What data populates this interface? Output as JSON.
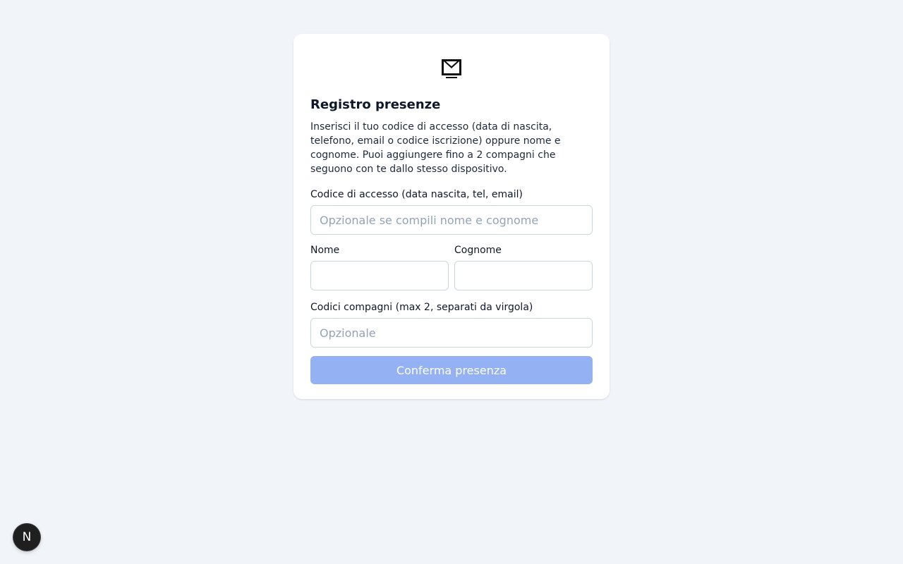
{
  "form": {
    "logo_icon": "roma-mail-logo-icon",
    "title": "Registro presenze",
    "description": "Inserisci il tuo codice di accesso (data di nascita, telefono, email o codice iscrizione) oppure nome e cognome. Puoi aggiungere fino a 2 compagni che seguono con te dallo stesso dispositivo.",
    "access_code": {
      "label": "Codice di accesso (data nascita, tel, email)",
      "placeholder": "Opzionale se compili nome e cognome",
      "value": ""
    },
    "first_name": {
      "label": "Nome",
      "value": ""
    },
    "last_name": {
      "label": "Cognome",
      "value": ""
    },
    "companions": {
      "label": "Codici compagni (max 2, separati da virgola)",
      "placeholder": "Opzionale",
      "value": ""
    },
    "submit_label": "Conferma presenza",
    "submit_color": "#93b1f3"
  },
  "dev_badge": {
    "letter": "N",
    "icon": "nextjs-icon"
  }
}
